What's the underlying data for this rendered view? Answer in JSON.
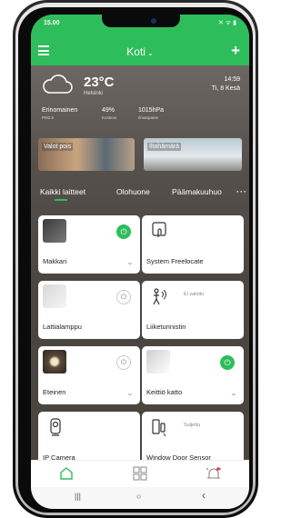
{
  "status_bar": {
    "time": "15.00",
    "right_icons": "✕ ᯤ ▮"
  },
  "header": {
    "title": "Koti",
    "chevron": "⌄",
    "add_icon": "+"
  },
  "weather": {
    "temperature": "23°C",
    "city": "Helsinki",
    "time": "14:59",
    "date": "Ti, 8 Kesä",
    "stats": [
      {
        "value": "Erinomainen",
        "label": "PM2.5"
      },
      {
        "value": "49%",
        "label": "Kosteus"
      },
      {
        "value": "1015hPa",
        "label": "Ilmanpaine"
      }
    ]
  },
  "scenes": [
    {
      "label": "Valot pois"
    },
    {
      "label": "Iltahämärä"
    }
  ],
  "tabs": [
    {
      "label": "Kaikki laitteet",
      "active": true
    },
    {
      "label": "Olohuone"
    },
    {
      "label": "Päämakuuhuo"
    },
    {
      "label": "···"
    }
  ],
  "devices": [
    {
      "name": "Makkari",
      "icon": "lamp-thumb",
      "power": "on",
      "expand": "⌄"
    },
    {
      "name": "System Freelocate",
      "icon": "touch-icon"
    },
    {
      "name": "Lattialamppu",
      "icon": "floor-lamp-thumb",
      "power": "off",
      "expand": "⌄"
    },
    {
      "name": "Liiketunnistin",
      "icon": "motion-sensor-icon",
      "status": "Ei valoitu"
    },
    {
      "name": "Eteinen",
      "icon": "ceiling-light-thumb",
      "power": "off",
      "expand": "⌄"
    },
    {
      "name": "Keittiö katto",
      "icon": "kitchen-light-thumb",
      "power": "on",
      "expand": "⌄"
    },
    {
      "name": "IP Camera",
      "icon": "camera-icon"
    },
    {
      "name": "Window Door Sensor",
      "icon": "door-sensor-icon",
      "status": "Suljettu"
    }
  ],
  "power_symbol": "⏻",
  "bottom_nav": [
    {
      "name": "home-icon"
    },
    {
      "name": "grid-icon"
    },
    {
      "name": "alarm-icon"
    }
  ],
  "system_nav": {
    "recent": "|||",
    "home": "○",
    "back": "‹"
  },
  "colors": {
    "accent": "#2ebd5b",
    "card": "#ffffff"
  }
}
